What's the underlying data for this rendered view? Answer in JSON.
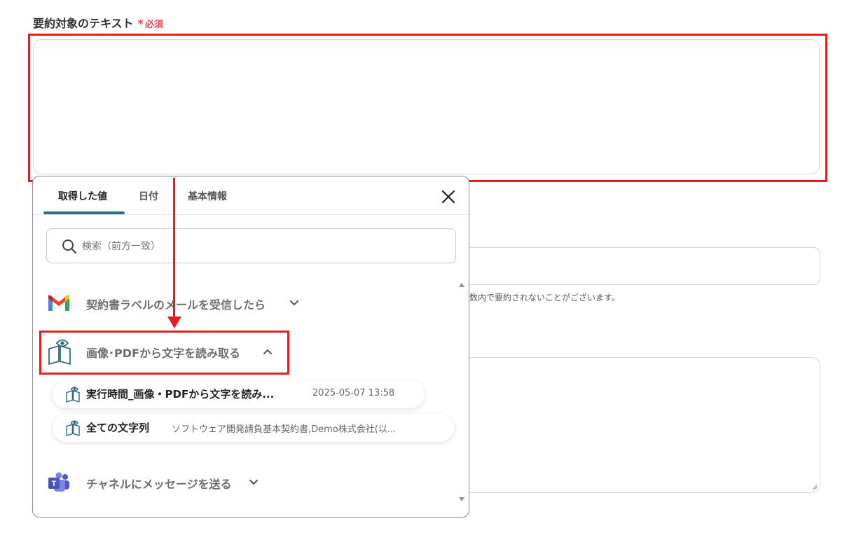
{
  "field": {
    "label": "要約対象のテキスト",
    "required_mark": "*",
    "required_text": "必須"
  },
  "background": {
    "note": "数内で要約されないことがございます。"
  },
  "popup": {
    "tabs": [
      {
        "label": "取得した値",
        "active": true
      },
      {
        "label": "日付",
        "active": false
      },
      {
        "label": "基本情報",
        "active": false
      }
    ],
    "search": {
      "placeholder": "検索（前方一致）",
      "value": ""
    },
    "groups": [
      {
        "label": "契約書ラベルのメールを受信したら",
        "icon": "gmail-icon",
        "expanded": false
      },
      {
        "label": "画像･PDFから文字を読み取る",
        "icon": "ocr-book-eye-icon",
        "expanded": true
      },
      {
        "label": "チャネルにメッセージを送る",
        "icon": "teams-icon",
        "expanded": false
      }
    ],
    "items": [
      {
        "title": "実行時間_画像・PDFから文字を読み...",
        "meta": "2025-05-07 13:58",
        "icon": "ocr-book-eye-icon"
      },
      {
        "title": "全ての文字列",
        "meta": "ソフトウェア開発請負基本契約書,Demo株式会社(以...",
        "icon": "ocr-book-eye-icon"
      }
    ]
  },
  "colors": {
    "accent_tab": "#2c6e7a",
    "highlight": "#e02020",
    "required": "#e5484d"
  }
}
